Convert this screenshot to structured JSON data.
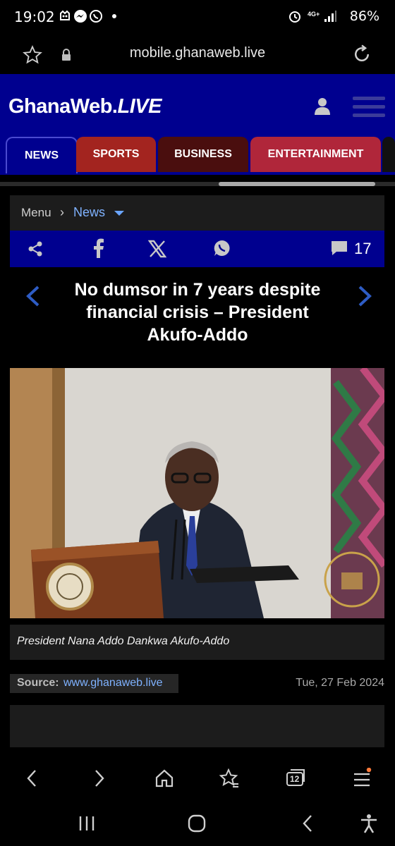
{
  "status_bar": {
    "time": "19:02",
    "network": "4G+",
    "battery": "86%"
  },
  "browser": {
    "url": "mobile.ghanaweb.live",
    "tabs_count": "12"
  },
  "site": {
    "logo_main": "GhanaWeb.",
    "logo_live": "LIVE",
    "nav_tabs": [
      {
        "label": "NEWS",
        "color": "#00008f"
      },
      {
        "label": "SPORTS",
        "color": "#a3241f"
      },
      {
        "label": "BUSINESS",
        "color": "#4a0e0e"
      },
      {
        "label": "ENTERTAINMENT",
        "color": "#b0263a"
      }
    ]
  },
  "breadcrumb": {
    "menu": "Menu",
    "separator": "›",
    "current": "News"
  },
  "share_bar": {
    "comment_count": "17"
  },
  "article": {
    "headline": "No dumsor in 7 years despite financial crisis – President Akufo-Addo",
    "caption": "President Nana Addo Dankwa Akufo-Addo",
    "source_label": "Source:",
    "source_value": "www.ghanaweb.live",
    "date": "Tue, 27 Feb 2024"
  },
  "icons": [
    "star-icon",
    "lock-icon",
    "reload-icon",
    "user-icon",
    "hamburger-icon",
    "share-icon",
    "facebook-icon",
    "x-icon",
    "whatsapp-icon",
    "comment-icon",
    "chevron-left-icon",
    "chevron-right-icon",
    "back-icon",
    "forward-icon",
    "home-icon",
    "bookmark-icon",
    "tabs-icon",
    "menu-icon"
  ],
  "colors": {
    "brand_blue": "#00008f",
    "link_blue": "#7fb2ff",
    "sports": "#a3241f",
    "business": "#4a0e0e",
    "entertainment": "#b0263a"
  }
}
